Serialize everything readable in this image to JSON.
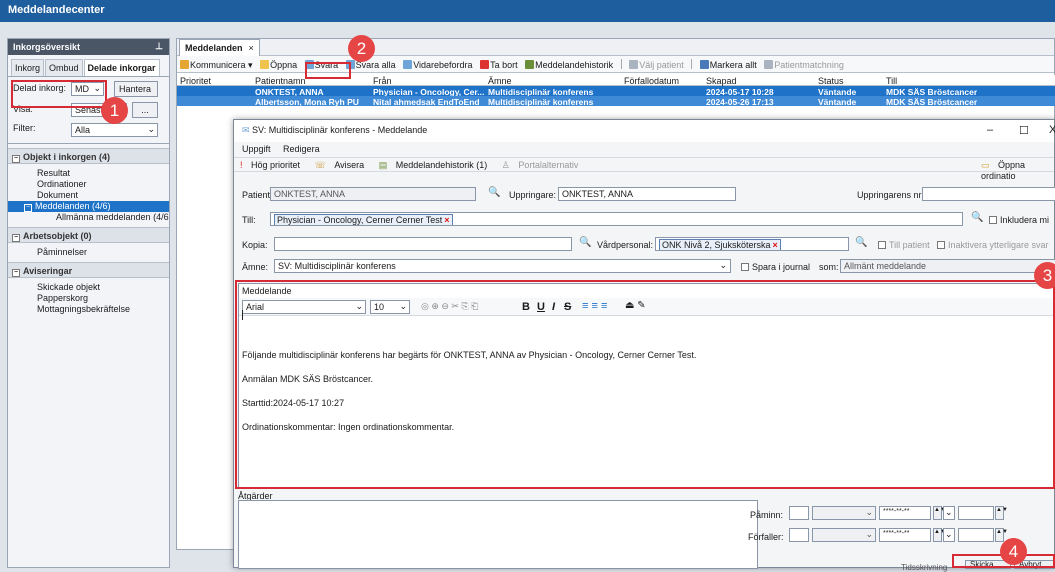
{
  "app": {
    "title": "Meddelandecenter"
  },
  "left": {
    "header": "Inkorgsöversikt",
    "pin": "⊥",
    "tabs": [
      "Inkorg",
      "Ombud",
      "Delade inkorgar"
    ],
    "shared_inbox_label": "Delad inkorg:",
    "shared_inbox_value": "MD",
    "manage_btn": "Hantera",
    "view_label": "Visa:",
    "view_value": "Senaste",
    "view_btn": "...",
    "filter_label": "Filter:",
    "filter_value": "Alla",
    "group_inbox": "Objekt i inkorgen (4)",
    "inbox_items": [
      "Resultat",
      "Ordinationer",
      "Dokument"
    ],
    "messages_item": "Meddelanden (4/6)",
    "messages_sub": "Allmänna meddelanden (4/6",
    "group_work": "Arbetsobjekt (0)",
    "work_items": [
      "Påminnelser"
    ],
    "group_notif": "Aviseringar",
    "notif_items": [
      "Skickade objekt",
      "Papperskorg",
      "Mottagningsbekräftelse"
    ]
  },
  "main": {
    "tab_label": "Meddelanden",
    "tab_close": "×",
    "toolbar": {
      "communicate": "Kommunicera ▾",
      "open": "Öppna",
      "reply": "Svara",
      "reply_all": "Svara alla",
      "forward": "Vidarebefordra",
      "delete": "Ta bort",
      "history": "Meddelandehistorik",
      "choose_patient": "Välj patient",
      "mark_all": "Markera allt",
      "patient_match": "Patientmatchning"
    },
    "columns": [
      "Prioritet",
      "Patientnamn",
      "Från",
      "Ämne",
      "Förfallodatum",
      "Skapad",
      "Status",
      "Till"
    ],
    "rows": [
      {
        "patient": "ONKTEST, ANNA",
        "from": "Physician - Oncology, Cer...",
        "subject": "Multidisciplinär konferens",
        "created": "2024-05-17 10:28",
        "status": "Väntande",
        "to": "MDK SÄS Bröstcancer"
      },
      {
        "patient": "Albertsson, Mona Ryh PU",
        "from": "Nital ahmedsak EndToEnd",
        "subject": "Multidisciplinär konferens",
        "created": "2024-05-26 17:13",
        "status": "Väntande",
        "to": "MDK SÄS Bröstcancer"
      }
    ]
  },
  "dialog": {
    "title": "SV: Multidisciplinär konferens - Meddelande",
    "min": "–",
    "max": "☐",
    "close": "X",
    "menu": [
      "Uppgift",
      "Redigera"
    ],
    "toolbar": {
      "high_priority": "Hög prioritet",
      "notify": "Avisera",
      "history": "Meddelandehistorik (1)",
      "portal": "Portalalternativ",
      "open_order": "Öppna ordinatio"
    },
    "patient_label": "Patient:",
    "patient_value": "ONKTEST, ANNA",
    "originator_label": "Uppringare:",
    "originator_value": "ONKTEST, ANNA",
    "originator_nr_label": "Uppringarens nr:",
    "to_label": "Till:",
    "to_chip": "Physician - Oncology, Cerner Cerner Test",
    "include_label": "Inkludera mi",
    "cc_label": "Kopia:",
    "care_staff_label": "Vårdpersonal:",
    "care_staff_chip": "ONK Nivå 2, Sjuksköterska",
    "to_patient": "Till patient",
    "deactivate_replies": "Inaktivera ytterligare svar",
    "subject_label": "Ämne:",
    "subject_value": "SV: Multidisciplinär konferens",
    "save_journal": "Spara i journal",
    "as_label": "som:",
    "as_value": "Allmänt meddelande",
    "editor": {
      "header": "Meddelande",
      "font": "Arial",
      "size": "10",
      "tools": [
        "B",
        "U",
        "I",
        "S"
      ],
      "lines": [
        "Följande multidisciplinär konferens har begärts för ONKTEST, ANNA av Physician - Oncology, Cerner Cerner Test.",
        "Anmälan MDK SÄS Bröstcancer.",
        "Starttid:2024-05-17 10:27",
        "Ordinationskommentar: Ingen ordinationskommentar."
      ]
    },
    "actions_label": "Åtgärder",
    "reminder_label": "Påminn:",
    "due_label": "Förfaller:",
    "date_placeholder": "****-**-**",
    "bottom_left": "Tidsskrivning",
    "send_btn": "Skicka",
    "send_right": "Avbryt"
  },
  "badges": [
    "1",
    "2",
    "3",
    "4"
  ],
  "colors": {
    "titlebar": "#1f5e9e",
    "selection": "#1e73c9",
    "highlight": "#d62b35",
    "badge": "#e64545"
  }
}
